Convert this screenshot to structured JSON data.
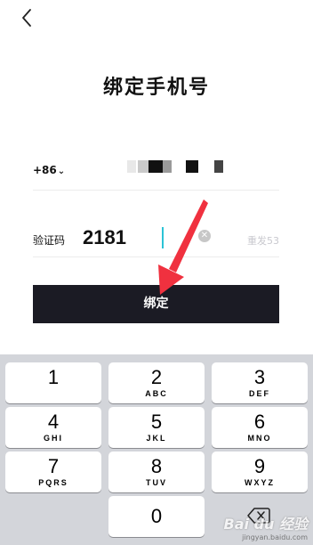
{
  "header": {
    "back_icon": "chevron-left-icon",
    "title": "绑定手机号"
  },
  "phone_row": {
    "country_code": "+86",
    "country_chevron": "chevron-down-icon",
    "phone_masked": true
  },
  "code_row": {
    "label": "验证码",
    "value": "2181",
    "clear_icon": "clear-circle-icon",
    "resend_label": "重发53"
  },
  "bind_button": {
    "label": "绑定"
  },
  "annotation": {
    "arrow_color": "#f0313f"
  },
  "keyboard": {
    "keys": [
      {
        "num": "1",
        "letters": ""
      },
      {
        "num": "2",
        "letters": "ABC"
      },
      {
        "num": "3",
        "letters": "DEF"
      },
      {
        "num": "4",
        "letters": "GHI"
      },
      {
        "num": "5",
        "letters": "JKL"
      },
      {
        "num": "6",
        "letters": "MNO"
      },
      {
        "num": "7",
        "letters": "PQRS"
      },
      {
        "num": "8",
        "letters": "TUV"
      },
      {
        "num": "9",
        "letters": "WXYZ"
      },
      {
        "num": "0",
        "letters": ""
      }
    ],
    "delete_icon": "backspace-icon"
  },
  "watermark": {
    "brand": "Bai du 经验",
    "url": "jingyan.baidu.com"
  },
  "colors": {
    "button_bg": "#1b1b24",
    "cursor": "#2bc3d6",
    "keyboard_bg": "#d3d5da",
    "resend": "#c9c9cf"
  }
}
